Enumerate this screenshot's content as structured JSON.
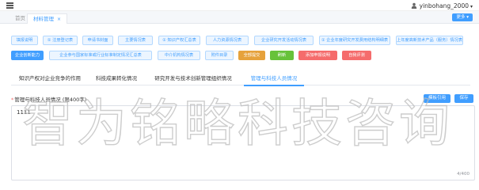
{
  "header": {
    "username": "yinbohang_2000"
  },
  "tabs": {
    "home_label": "首页",
    "active_label": "材料管理",
    "close_label": "×",
    "more_label": "更多"
  },
  "buttons_row1": [
    "填报说明",
    "① 注册登记表",
    "申请书封面",
    "主要情况表",
    "① 知识产权汇总表",
    "人力资源情况表",
    "企业研究开发活动情况表",
    "① 企业年度研究开发费用结构明细表",
    "上年度高新技术产品（服务）情况表"
  ],
  "buttons_row2": [
    "企业创新能力",
    "企业参与国家标准或行业标准制定情况汇总表",
    "中介机构情况表",
    "附件目录",
    "全部提交",
    "刷新",
    "添加申报说明",
    "自我评测"
  ],
  "subtabs": [
    "知识产权对企业竞争的作用",
    "科技成果转化情况",
    "研究开发与技术创新管理组织情况",
    "管理与科技人员情况"
  ],
  "form": {
    "label": "管理与科技人员情况 (限400字)",
    "required_mark": "*",
    "template_button": "模板引用",
    "save_button": "保存",
    "value": "1111",
    "counter": "4/400"
  },
  "watermark_text": "智为铭略科技咨询"
}
